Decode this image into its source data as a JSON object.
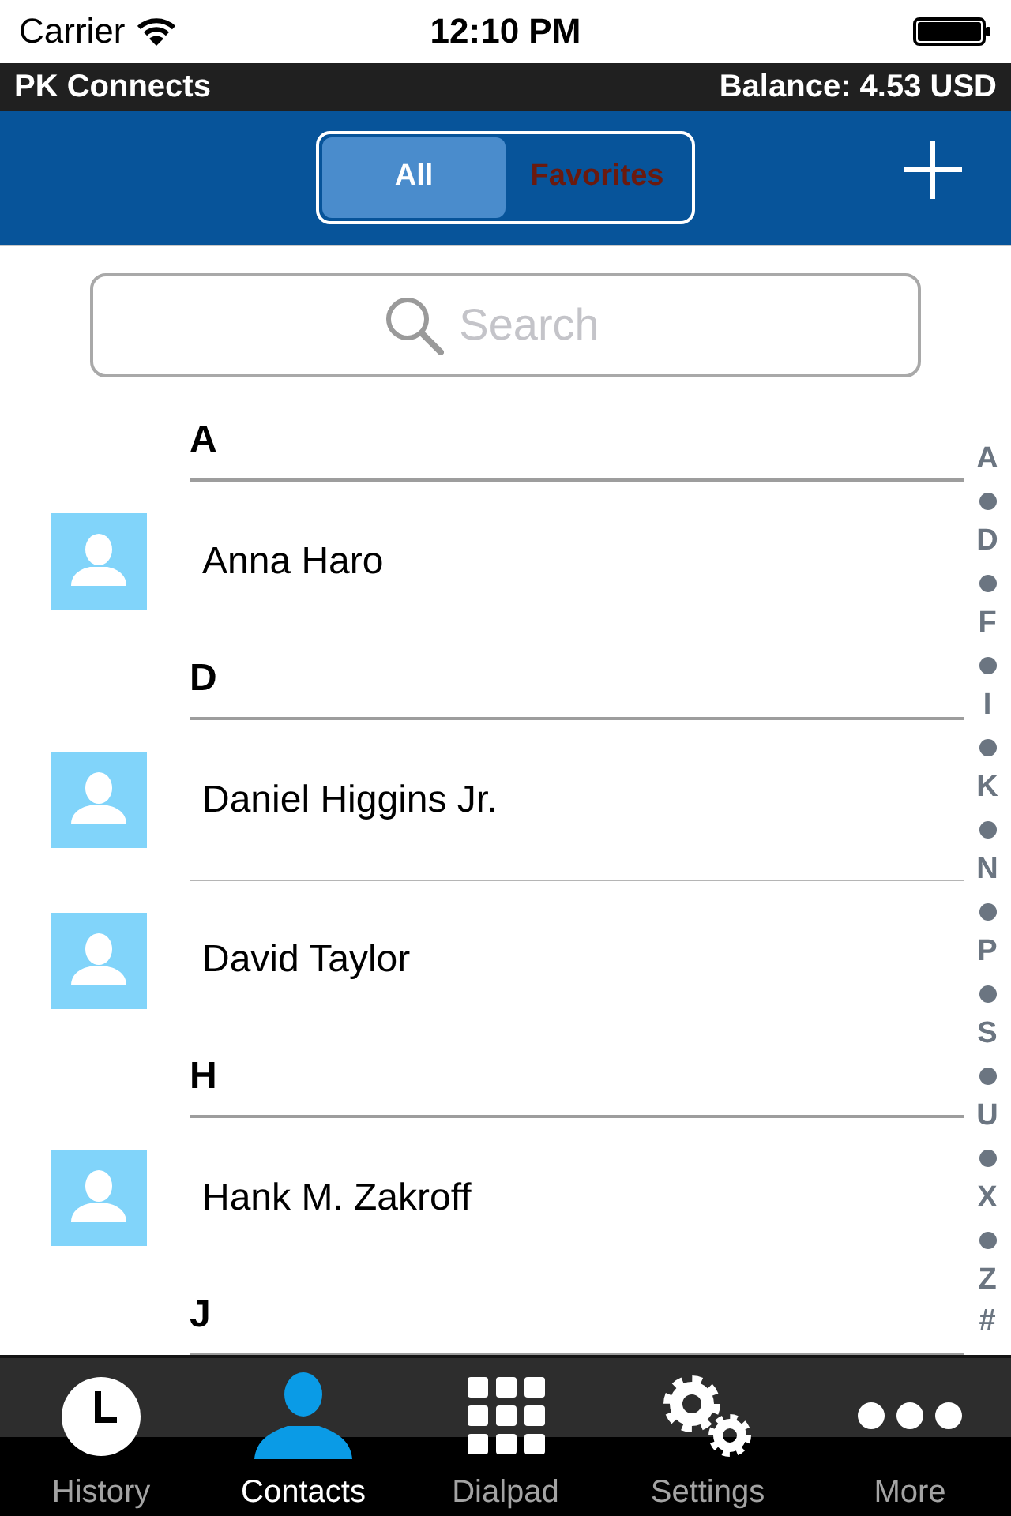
{
  "status_bar": {
    "carrier": "Carrier",
    "time": "12:10 PM"
  },
  "app_bar": {
    "title": "PK Connects",
    "balance": "Balance: 4.53 USD"
  },
  "segments": [
    {
      "label": "All",
      "selected": true
    },
    {
      "label": "Favorites",
      "selected": false
    }
  ],
  "search": {
    "placeholder": "Search"
  },
  "sections": [
    {
      "letter": "A",
      "contacts": [
        {
          "name": "Anna Haro"
        }
      ]
    },
    {
      "letter": "D",
      "contacts": [
        {
          "name": "Daniel Higgins Jr."
        },
        {
          "name": "David Taylor"
        }
      ]
    },
    {
      "letter": "H",
      "contacts": [
        {
          "name": "Hank M. Zakroff"
        }
      ]
    },
    {
      "letter": "J"
    }
  ],
  "index": [
    {
      "kind": "letter",
      "label": "A"
    },
    {
      "kind": "dot"
    },
    {
      "kind": "letter",
      "label": "D"
    },
    {
      "kind": "dot"
    },
    {
      "kind": "letter",
      "label": "F"
    },
    {
      "kind": "dot"
    },
    {
      "kind": "letter",
      "label": "I"
    },
    {
      "kind": "dot"
    },
    {
      "kind": "letter",
      "label": "K"
    },
    {
      "kind": "dot"
    },
    {
      "kind": "letter",
      "label": "N"
    },
    {
      "kind": "dot"
    },
    {
      "kind": "letter",
      "label": "P"
    },
    {
      "kind": "dot"
    },
    {
      "kind": "letter",
      "label": "S"
    },
    {
      "kind": "dot"
    },
    {
      "kind": "letter",
      "label": "U"
    },
    {
      "kind": "dot"
    },
    {
      "kind": "letter",
      "label": "X"
    },
    {
      "kind": "dot"
    },
    {
      "kind": "letter",
      "label": "Z"
    },
    {
      "kind": "letter",
      "label": "#"
    }
  ],
  "tabs": [
    {
      "label": "History",
      "selected": false
    },
    {
      "label": "Contacts",
      "selected": true
    },
    {
      "label": "Dialpad",
      "selected": false
    },
    {
      "label": "Settings",
      "selected": false
    },
    {
      "label": "More",
      "selected": false
    }
  ]
}
